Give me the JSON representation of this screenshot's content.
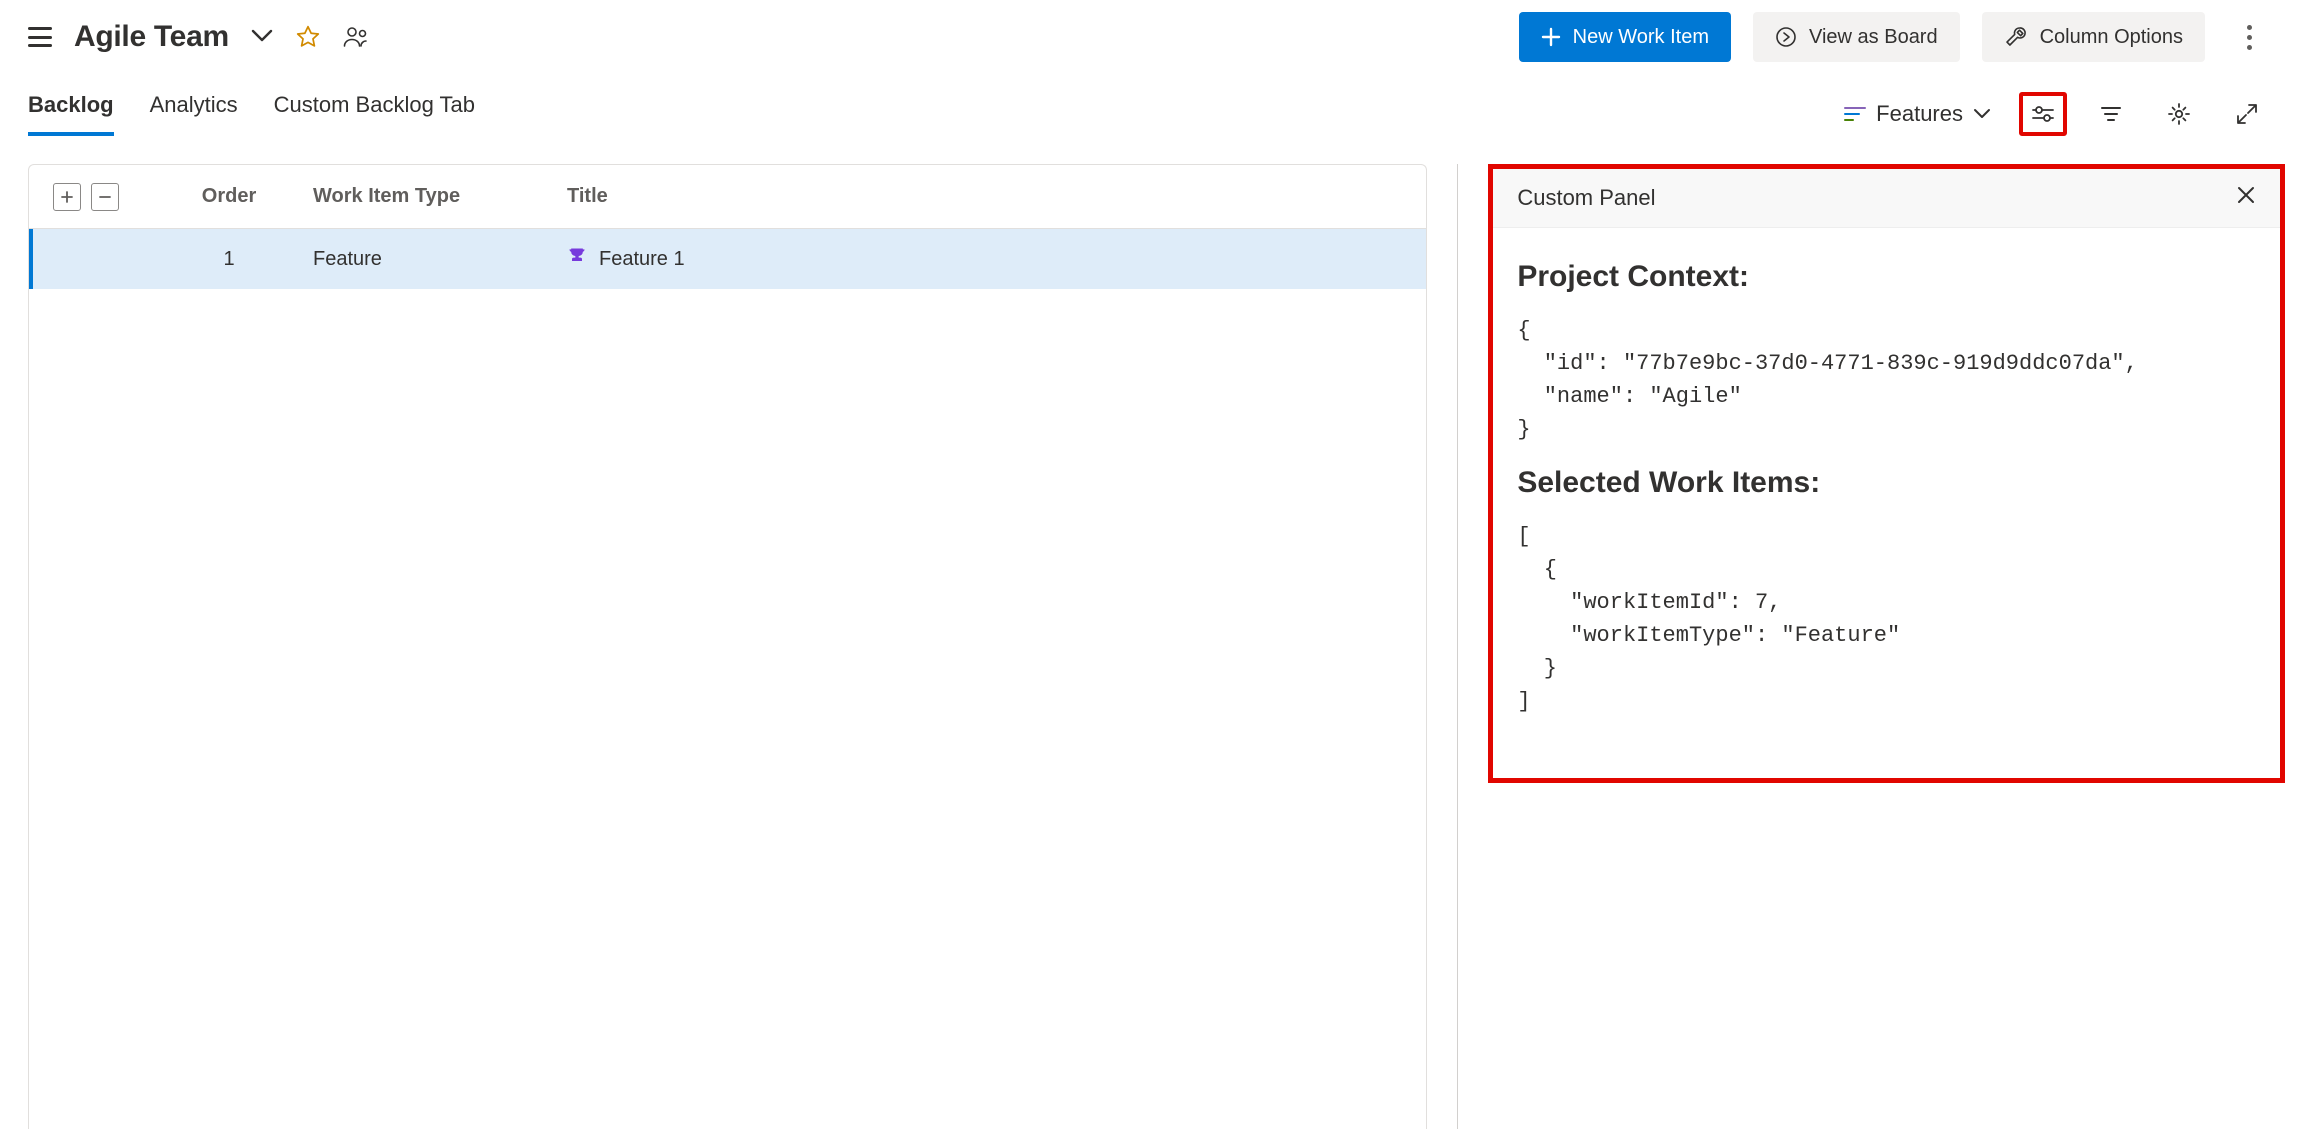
{
  "header": {
    "team_name": "Agile Team",
    "new_work_item_label": "New Work Item",
    "view_as_board_label": "View as Board",
    "column_options_label": "Column Options"
  },
  "tabs": {
    "items": [
      {
        "label": "Backlog",
        "active": true
      },
      {
        "label": "Analytics",
        "active": false
      },
      {
        "label": "Custom Backlog Tab",
        "active": false
      }
    ],
    "backlog_level_label": "Features"
  },
  "grid": {
    "columns": {
      "order": "Order",
      "work_item_type": "Work Item Type",
      "title": "Title"
    },
    "rows": [
      {
        "order": "1",
        "type": "Feature",
        "title": "Feature 1",
        "selected": true
      }
    ]
  },
  "panel": {
    "title": "Custom Panel",
    "section_project_context": "Project Context:",
    "section_selected_items": "Selected Work Items:",
    "project_context_json": "{\n  \"id\": \"77b7e9bc-37d0-4771-839c-919d9ddc07da\",\n  \"name\": \"Agile\"\n}",
    "selected_items_json": "[\n  {\n    \"workItemId\": 7,\n    \"workItemType\": \"Feature\"\n  }\n]"
  }
}
